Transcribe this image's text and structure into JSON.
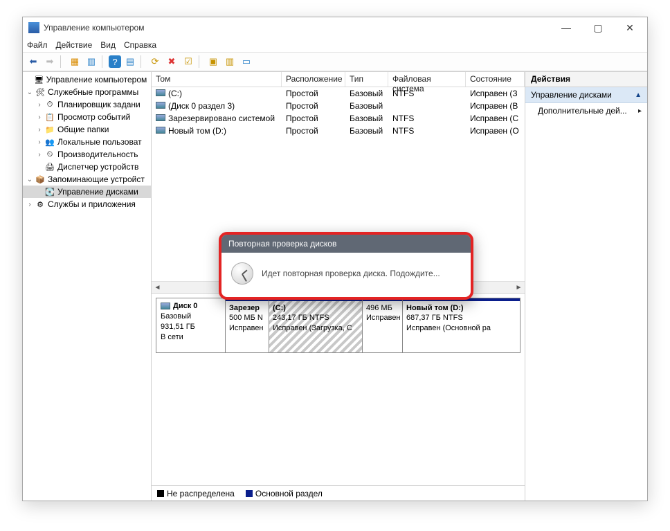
{
  "titlebar": {
    "title": "Управление компьютером"
  },
  "menubar": {
    "file": "Файл",
    "action": "Действие",
    "view": "Вид",
    "help": "Справка"
  },
  "tree": {
    "root": "Управление компьютером (л",
    "system_tools": "Служебные программы",
    "task_scheduler": "Планировщик задани",
    "event_viewer": "Просмотр событий",
    "shared_folders": "Общие папки",
    "local_users": "Локальные пользоват",
    "performance": "Производительность",
    "device_manager": "Диспетчер устройств",
    "storage": "Запоминающие устройст",
    "disk_management": "Управление дисками",
    "services_apps": "Службы и приложения"
  },
  "columns": {
    "tom": "Том",
    "loc": "Расположение",
    "type": "Тип",
    "fs": "Файловая система",
    "state": "Состояние"
  },
  "volumes": [
    {
      "name": "(C:)",
      "loc": "Простой",
      "type": "Базовый",
      "fs": "NTFS",
      "state": "Исправен (З"
    },
    {
      "name": "(Диск 0 раздел 3)",
      "loc": "Простой",
      "type": "Базовый",
      "fs": "",
      "state": "Исправен (В"
    },
    {
      "name": "Зарезервировано системой",
      "loc": "Простой",
      "type": "Базовый",
      "fs": "NTFS",
      "state": "Исправен (С"
    },
    {
      "name": "Новый том (D:)",
      "loc": "Простой",
      "type": "Базовый",
      "fs": "NTFS",
      "state": "Исправен (О"
    }
  ],
  "disk": {
    "label": "Диск 0",
    "type": "Базовый",
    "size": "931,51 ГБ",
    "status": "В сети"
  },
  "parts": [
    {
      "title": "Зарезер",
      "size": "500 МБ N",
      "status": "Исправен"
    },
    {
      "title": "(C:)",
      "size": "243,17 ГБ NTFS",
      "status": "Исправен (Загрузка, С"
    },
    {
      "title": "",
      "size": "496 МБ",
      "status": "Исправен"
    },
    {
      "title": "Новый том  (D:)",
      "size": "687,37 ГБ NTFS",
      "status": "Исправен (Основной ра"
    }
  ],
  "legend": {
    "unallocated": "Не распределена",
    "primary": "Основной раздел"
  },
  "actions": {
    "header": "Действия",
    "category": "Управление дисками",
    "more": "Дополнительные дей..."
  },
  "dialog": {
    "title": "Повторная проверка дисков",
    "text": "Идет повторная проверка диска. Подождите..."
  }
}
